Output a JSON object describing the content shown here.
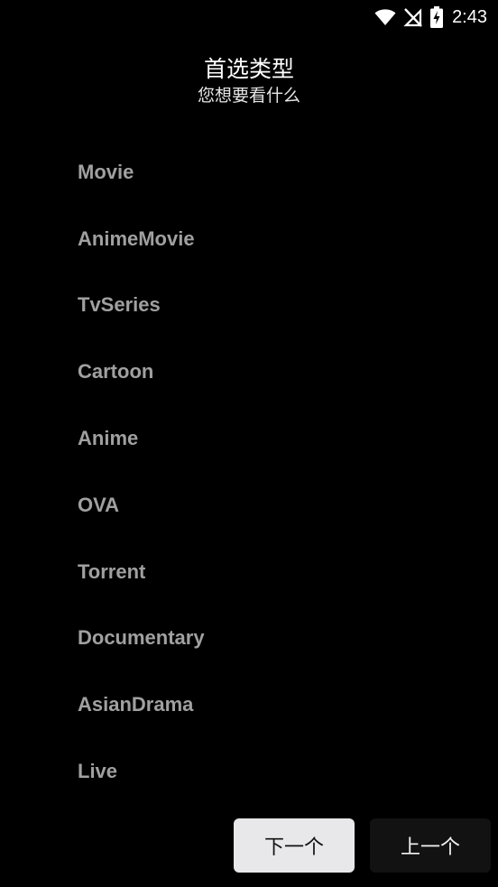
{
  "status_bar": {
    "time": "2:43",
    "icons": [
      "wifi-icon",
      "no-signal-icon",
      "battery-charging-icon"
    ]
  },
  "header": {
    "title": "首选类型",
    "subtitle": "您想要看什么"
  },
  "genres": [
    "Movie",
    "AnimeMovie",
    "TvSeries",
    "Cartoon",
    "Anime",
    "OVA",
    "Torrent",
    "Documentary",
    "AsianDrama",
    "Live"
  ],
  "buttons": {
    "next_label": "下一个",
    "prev_label": "上一个"
  },
  "colors": {
    "background": "#000000",
    "item_text": "#a0a0a0",
    "next_button_bg": "#e8e8eb",
    "prev_button_bg": "#121212"
  }
}
